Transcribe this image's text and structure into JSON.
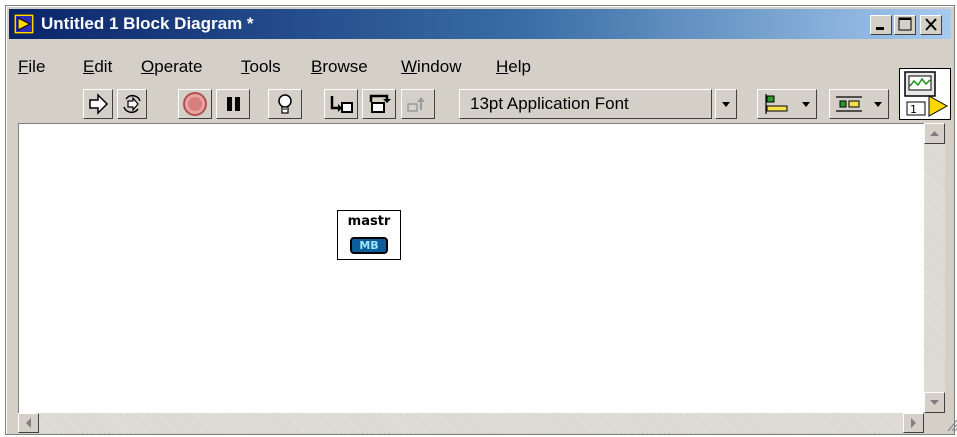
{
  "window": {
    "title": "Untitled 1 Block Diagram *"
  },
  "menu": {
    "items": [
      {
        "accel": "F",
        "rest": "ile"
      },
      {
        "accel": "E",
        "rest": "dit"
      },
      {
        "accel": "O",
        "rest": "perate"
      },
      {
        "accel": "T",
        "rest": "ools"
      },
      {
        "accel": "B",
        "rest": "rowse"
      },
      {
        "accel": "W",
        "rest": "indow"
      },
      {
        "accel": "H",
        "rest": "elp"
      }
    ]
  },
  "toolbar": {
    "font_selector_value": "13pt Application Font",
    "buttons": [
      "run-arrow-icon",
      "run-continuously-icon",
      "abort-icon",
      "pause-icon",
      "highlight-execution-icon",
      "step-into-icon",
      "step-over-icon",
      "step-out-icon",
      "align-objects-icon",
      "distribute-objects-icon"
    ]
  },
  "vi_icon": {
    "number": "1"
  },
  "diagram": {
    "node": {
      "label": "mastr",
      "badge": "MB"
    }
  },
  "colors": {
    "title_bar_start": "#0a246a",
    "title_bar_end": "#a6caf0",
    "window_face": "#d4d0c8",
    "node_badge": "#0b5e99"
  }
}
